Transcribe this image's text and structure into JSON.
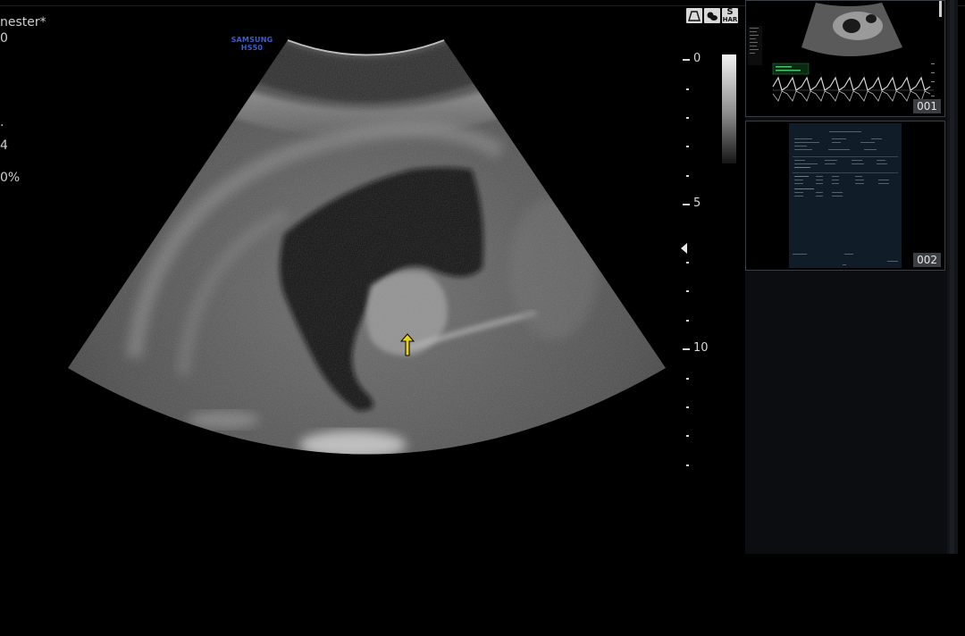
{
  "left_info": {
    "line1": "nester*",
    "line2": "0",
    "line3": ".",
    "line4": "4",
    "line5": "0%"
  },
  "probe": {
    "brand": "SAMSUNG",
    "model": "HS50"
  },
  "depth_scale": {
    "labels": [
      "0",
      "5",
      "10"
    ]
  },
  "mode_buttons": {
    "s_label": "S",
    "har_label": "HAR"
  },
  "thumbnails": [
    {
      "number": "001"
    },
    {
      "number": "002"
    }
  ],
  "colors": {
    "arrow": "#e8d21a",
    "probe_label": "#3e5ec9",
    "thumb_border": "#3a3f46",
    "doppler_trace": "#d8d8d8"
  }
}
